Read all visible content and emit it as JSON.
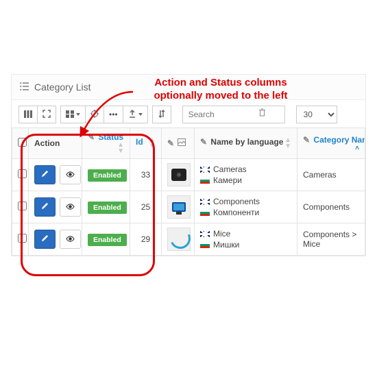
{
  "annotation": {
    "text": "Action and Status columns optionally moved to the left"
  },
  "panel": {
    "title": "Category List"
  },
  "toolbar": {
    "page_size": "30"
  },
  "search": {
    "placeholder": "Search"
  },
  "columns": {
    "action": "Action",
    "status": "Status",
    "id": "Id",
    "image": "",
    "name_by_lang": "Name by language",
    "category_name": "Category Name"
  },
  "rows": [
    {
      "id": "33",
      "status": "Enabled",
      "names": {
        "en": "Cameras",
        "bg": "Камери"
      },
      "cat_name": "Cameras",
      "thumb": "camera"
    },
    {
      "id": "25",
      "status": "Enabled",
      "names": {
        "en": "Components",
        "bg": "Компоненти"
      },
      "cat_name": "Components",
      "thumb": "monitor"
    },
    {
      "id": "29",
      "status": "Enabled",
      "names": {
        "en": "Mice",
        "bg": "Мишки"
      },
      "cat_name": "Components  >  Mice",
      "thumb": "swoosh"
    }
  ]
}
